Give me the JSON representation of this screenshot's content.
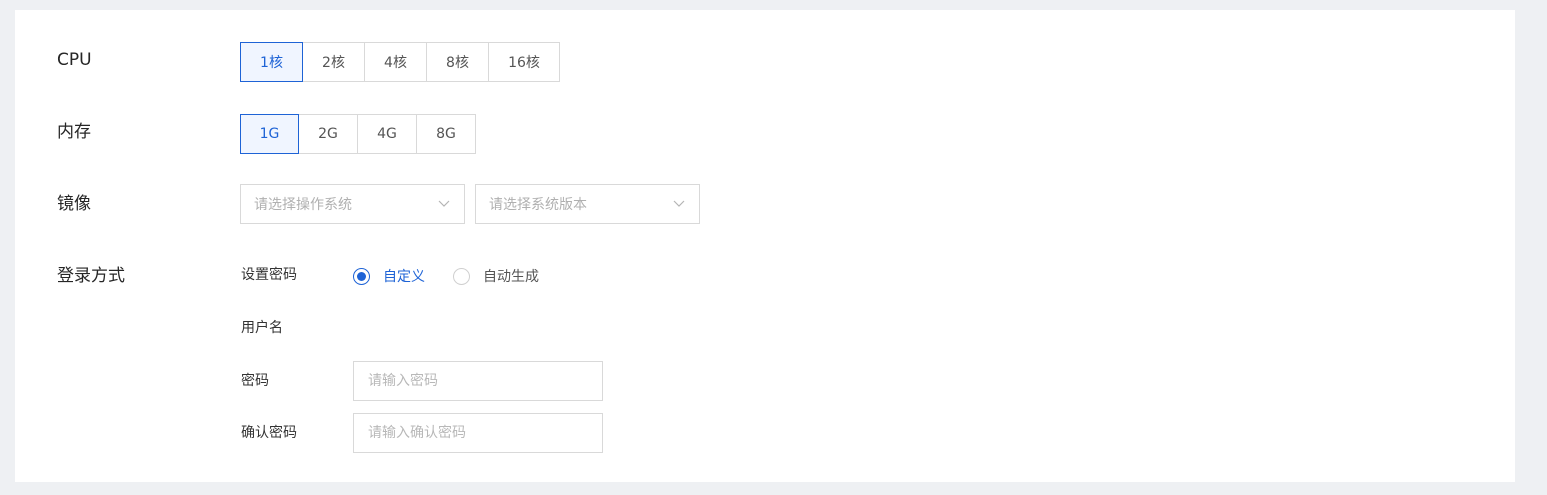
{
  "cpu": {
    "label": "CPU",
    "options": [
      "1核",
      "2核",
      "4核",
      "8核",
      "16核"
    ],
    "selected": "1核"
  },
  "memory": {
    "label": "内存",
    "options": [
      "1G",
      "2G",
      "4G",
      "8G"
    ],
    "selected": "1G"
  },
  "image": {
    "label": "镜像",
    "os_placeholder": "请选择操作系统",
    "version_placeholder": "请选择系统版本"
  },
  "login": {
    "label": "登录方式",
    "set_password_label": "设置密码",
    "radio_custom": "自定义",
    "radio_auto": "自动生成",
    "radio_selected": "自定义",
    "username_label": "用户名",
    "password_label": "密码",
    "password_placeholder": "请输入密码",
    "confirm_label": "确认密码",
    "confirm_placeholder": "请输入确认密码"
  },
  "colors": {
    "accent": "#1e63d6",
    "page_bg": "#eef0f3",
    "border": "#d9d9d9"
  }
}
